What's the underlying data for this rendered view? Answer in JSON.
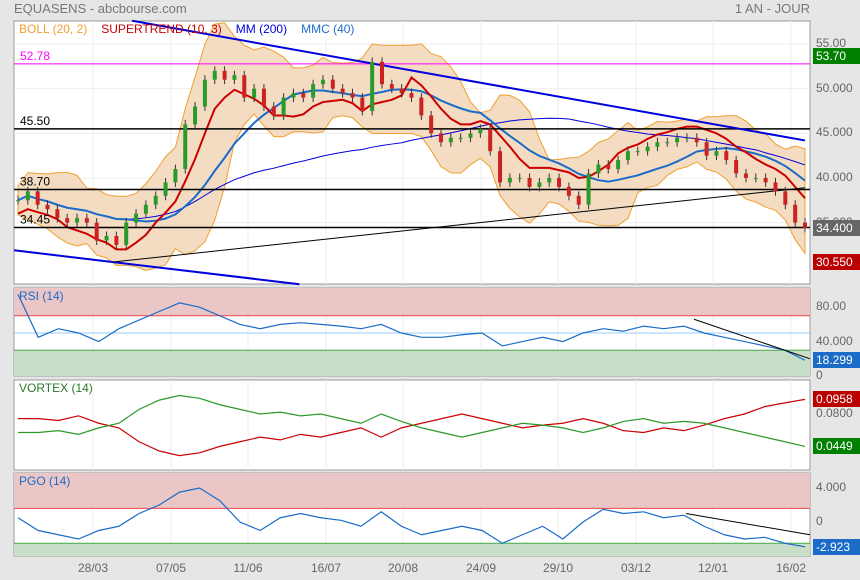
{
  "header": {
    "title": "EQUASENS - abcbourse.com",
    "period": "1 AN - JOUR"
  },
  "legend": [
    {
      "label": "BOLL (20, 2)",
      "color": "#f0a030"
    },
    {
      "label": "SUPERTREND (10, 3)",
      "color": "#cc0000"
    },
    {
      "label": "MM (200)",
      "color": "#0000dd"
    },
    {
      "label": "MMC (40)",
      "color": "#1a6cc8"
    }
  ],
  "levels": [
    {
      "label": "52.78",
      "value": 52.78,
      "color": "#ff00ff"
    },
    {
      "label": "45.50",
      "value": 45.5,
      "color": "#000000"
    },
    {
      "label": "38.70",
      "value": 38.7,
      "color": "#000000"
    },
    {
      "label": "34.45",
      "value": 34.45,
      "color": "#000000"
    }
  ],
  "price_tags": [
    {
      "label": "53.70",
      "value": 53.7,
      "color": "#008000"
    },
    {
      "label": "34.400",
      "value": 34.4,
      "color": "#666666"
    },
    {
      "label": "30.550",
      "value": 30.55,
      "color": "#bb0000"
    }
  ],
  "rsi_tag": {
    "label": "18.299",
    "color": "#1a6cc8"
  },
  "vortex_tags": [
    {
      "label": "0.0958",
      "color": "#bb0000"
    },
    {
      "label": "0.0449",
      "color": "#008000"
    }
  ],
  "pgo_tag": {
    "label": "-2.923",
    "color": "#1a6cc8"
  },
  "panels": {
    "rsi": "RSI (14)",
    "vortex": "VORTEX (14)",
    "pgo": "PGO (14)"
  },
  "chart_data": {
    "type": "line",
    "title": "EQUASENS",
    "x_ticks": [
      "28/03",
      "07/05",
      "11/06",
      "16/07",
      "20/08",
      "24/09",
      "29/10",
      "03/12",
      "12/01",
      "16/02"
    ],
    "price_axis": {
      "ticks": [
        "55.00",
        "50.000",
        "45.000",
        "40.000",
        "35.000"
      ],
      "ylim": [
        28,
        58
      ]
    },
    "close": [
      37.5,
      38.5,
      37,
      36.5,
      35.5,
      35,
      35.5,
      35,
      33,
      33.5,
      32.5,
      35,
      36,
      37,
      38,
      39.5,
      41,
      46,
      48,
      51,
      52,
      51,
      51.5,
      49,
      50,
      48,
      47,
      49,
      49.5,
      49,
      50.5,
      51,
      50,
      49.5,
      49,
      47.5,
      53,
      50.5,
      50,
      49.5,
      49,
      47,
      45,
      44,
      44.5,
      44.5,
      45,
      45.5,
      43,
      39.5,
      40,
      40,
      39,
      39.5,
      40,
      39,
      38,
      37,
      40.5,
      41.5,
      41,
      42,
      43,
      43,
      43.5,
      44,
      44,
      44.5,
      44.5,
      44,
      42.5,
      43,
      42,
      40.5,
      40,
      40,
      39.5,
      38.5,
      37,
      35,
      34.4
    ],
    "trendlines": [
      {
        "color": "#0000dd",
        "from": [
          11.6,
          57.6
        ],
        "to": [
          80,
          44.2
        ]
      },
      {
        "color": "#0000dd",
        "from": [
          -0.4,
          31.9
        ],
        "to": [
          28.6,
          28.1
        ]
      },
      {
        "color": "#000000",
        "from": [
          9.8,
          30.6
        ],
        "to": [
          80,
          38.9
        ]
      }
    ],
    "rsi": {
      "ticks": [
        "80.00",
        "40.000",
        "0"
      ],
      "levels": [
        70,
        50,
        30
      ],
      "values": [
        95,
        45,
        55,
        50,
        40,
        55,
        65,
        75,
        85,
        80,
        70,
        60,
        55,
        60,
        62,
        60,
        58,
        55,
        60,
        50,
        45,
        45,
        48,
        50,
        35,
        40,
        45,
        40,
        50,
        55,
        52,
        58,
        55,
        58,
        50,
        45,
        40,
        35,
        30,
        18.3
      ]
    },
    "vortex": {
      "ticks": [
        "0.0800",
        "0.0400"
      ],
      "vi_plus": [
        0.06,
        0.06,
        0.062,
        0.058,
        0.065,
        0.07,
        0.085,
        0.095,
        0.1,
        0.097,
        0.09,
        0.085,
        0.08,
        0.082,
        0.078,
        0.08,
        0.075,
        0.07,
        0.08,
        0.072,
        0.065,
        0.06,
        0.055,
        0.06,
        0.065,
        0.07,
        0.068,
        0.065,
        0.06,
        0.065,
        0.072,
        0.075,
        0.07,
        0.072,
        0.07,
        0.065,
        0.06,
        0.055,
        0.05,
        0.0449
      ],
      "vi_minus": [
        0.075,
        0.075,
        0.073,
        0.078,
        0.07,
        0.065,
        0.05,
        0.04,
        0.035,
        0.038,
        0.045,
        0.05,
        0.055,
        0.052,
        0.058,
        0.055,
        0.06,
        0.065,
        0.055,
        0.065,
        0.07,
        0.075,
        0.08,
        0.075,
        0.07,
        0.065,
        0.068,
        0.07,
        0.075,
        0.07,
        0.062,
        0.06,
        0.065,
        0.062,
        0.068,
        0.075,
        0.08,
        0.088,
        0.092,
        0.0958
      ]
    },
    "pgo": {
      "ticks": [
        "4.000",
        "0"
      ],
      "levels": [
        1.6,
        -2.5
      ],
      "values": [
        0.5,
        -1,
        -1.5,
        -2,
        -1,
        -0.5,
        1,
        2,
        3.5,
        4,
        2.5,
        0,
        -1,
        0.5,
        1,
        0.5,
        0.2,
        -0.5,
        1.2,
        -0.5,
        -1.5,
        -1,
        -0.5,
        -1,
        -2.5,
        -1.5,
        -0.5,
        -2,
        0,
        1.5,
        1,
        1.2,
        0.5,
        0.8,
        -0.5,
        -1.5,
        -2,
        -1.8,
        -2.5,
        -2.923
      ]
    }
  }
}
